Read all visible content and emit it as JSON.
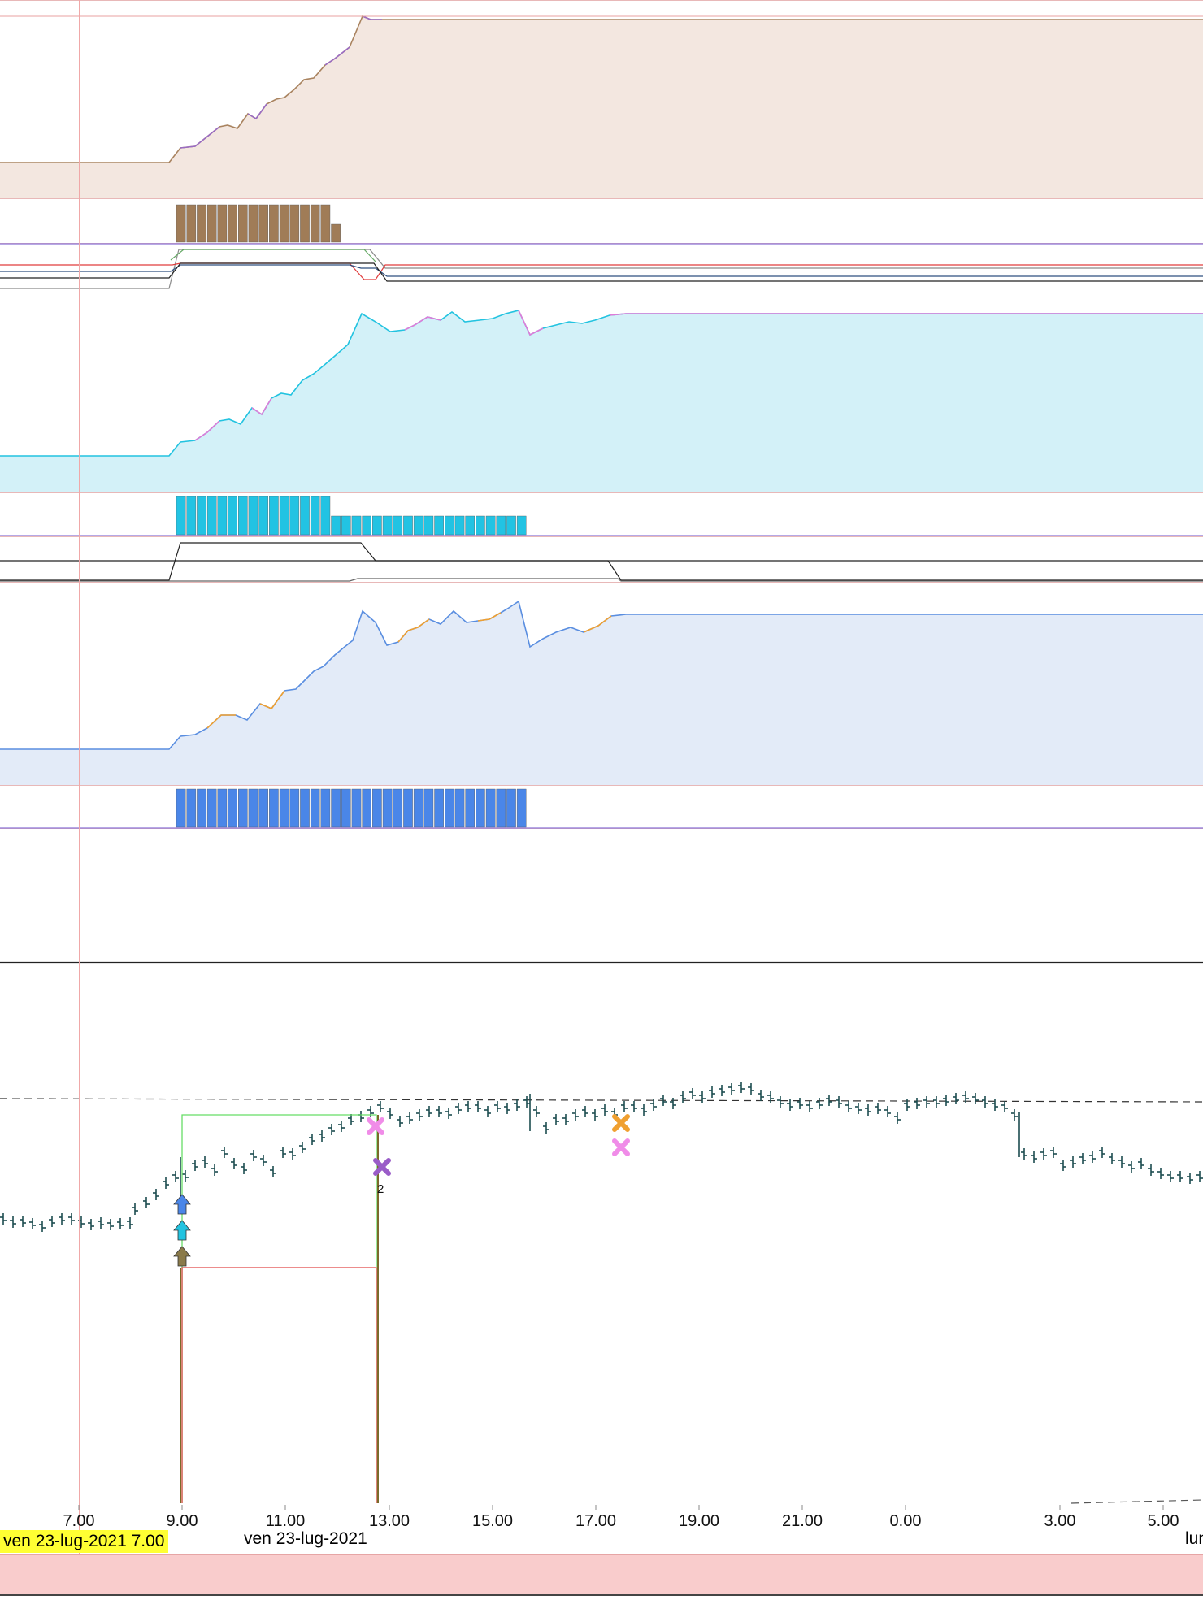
{
  "chart_data": {
    "type": "line",
    "x_axis": {
      "tick_labels": [
        "7.00",
        "9.00",
        "11.00",
        "13.00",
        "15.00",
        "17.00",
        "19.00",
        "21.00",
        "0.00",
        "3.00",
        "5.00"
      ]
    },
    "cursor": {
      "label": "ven 23-lug-2021 7.00"
    },
    "date_labels": {
      "center": "ven 23-lug-2021",
      "right": "lun"
    },
    "markers": {
      "exit_label": "2"
    },
    "panels": [
      {
        "kind": "equity",
        "fill": "#f3e7e0",
        "line": "#a9835f",
        "accent": "#9a6cc4",
        "bar_color": "#a07c57",
        "bars_full": 15,
        "bars_short": 1
      },
      {
        "kind": "equity",
        "fill": "#d3f1f8",
        "line": "#22c3e0",
        "accent": "#e07bd8",
        "bar_color": "#22c3e3",
        "bars_full": 15,
        "bars_short": 19
      },
      {
        "kind": "equity",
        "fill": "#e3ebf8",
        "line": "#5a8ee0",
        "accent": "#f0a030",
        "bar_color": "#4a86e8",
        "bars_full": 34,
        "bars_short": 0
      }
    ],
    "grid": false,
    "colors": {
      "candles": "#1d4d50",
      "cursor_line": "#f0a8a8",
      "entry_box": "#66dd66",
      "stop_line": "#e04848",
      "arrow_brown": "#8a7a4a",
      "arrow_cyan": "#22c3e0",
      "arrow_blue": "#4a86e8",
      "cross_pink": "#f08ce8",
      "cross_purple": "#9a5cc8",
      "cross_orange": "#f0a030"
    }
  }
}
